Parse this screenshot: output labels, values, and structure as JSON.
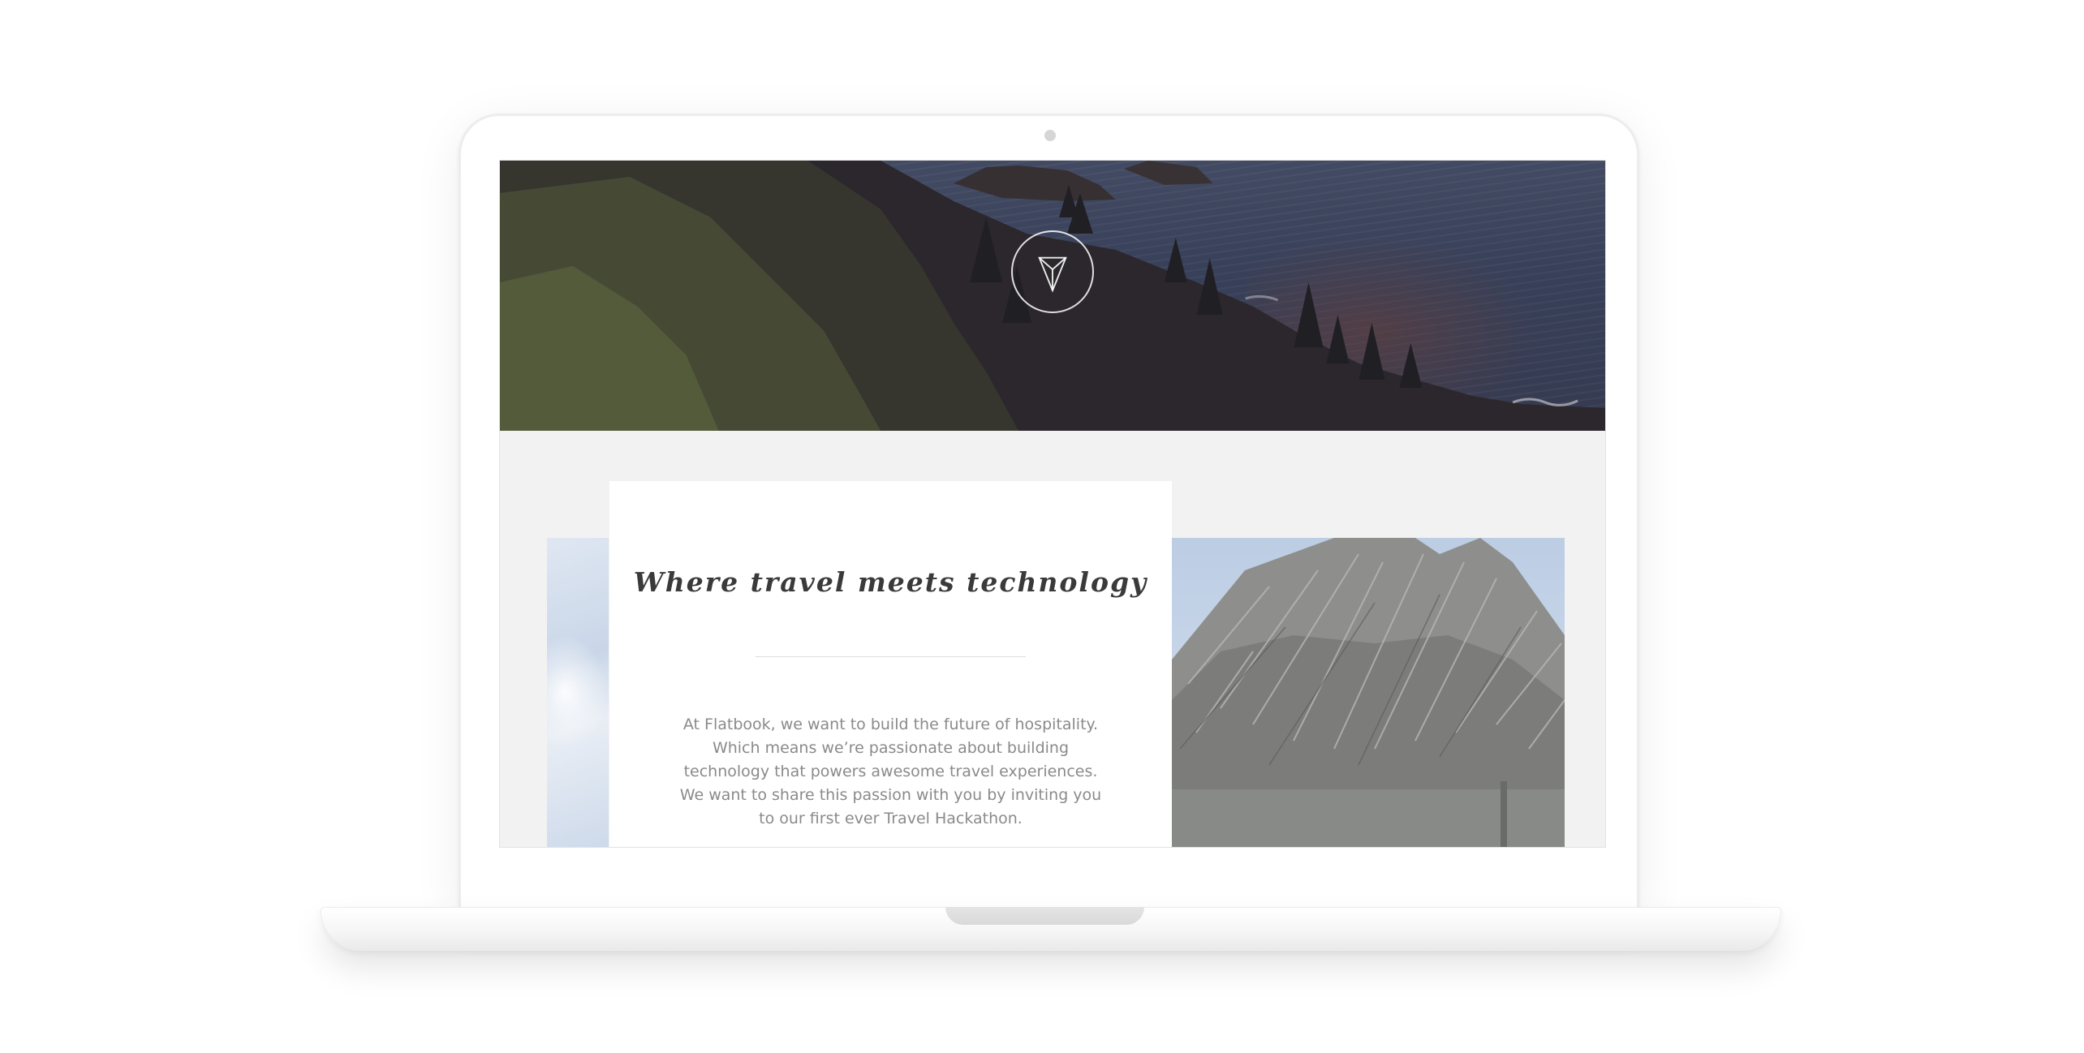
{
  "hero": {
    "logo_icon": "paper-plane-triangle-icon"
  },
  "intro": {
    "title": "Where travel meets technology",
    "body": "At Flatbook, we want to build the future of hospitality. Which means we’re passionate about building technology that powers awesome travel experiences. We want to share this passion with you by inviting you to our first ever Travel Hackathon."
  },
  "colors": {
    "background": "#ffffff",
    "screen_background": "#f2f2f2",
    "card_background": "#ffffff",
    "title_text": "#3a3a3a",
    "body_text": "#8a8a8a"
  }
}
